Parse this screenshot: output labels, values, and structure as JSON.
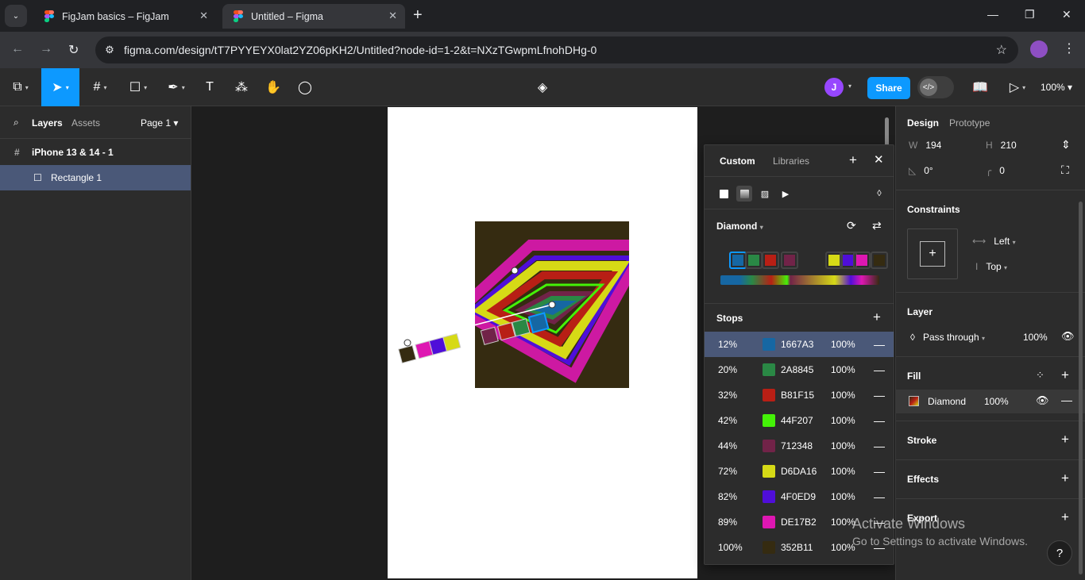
{
  "browser": {
    "tabs": [
      {
        "title": "FigJam basics – FigJam",
        "close": "✕"
      },
      {
        "title": "Untitled – Figma",
        "close": "✕"
      }
    ],
    "new_tab": "+",
    "url": "figma.com/design/tT7PYYEYX0lat2YZ06pKH2/Untitled?node-id=1-2&t=NXzTGwpmLfnohDHg-0",
    "window_controls": {
      "minimize": "—",
      "restore": "❐",
      "close": "✕"
    }
  },
  "toolbar": {
    "avatar": "J",
    "share": "Share",
    "zoom": "100%"
  },
  "left_panel": {
    "tab_layers": "Layers",
    "tab_assets": "Assets",
    "page": "Page 1",
    "layers": [
      {
        "name": "iPhone 13 & 14 - 1",
        "icon": "#"
      },
      {
        "name": "Rectangle 1",
        "icon": "☐"
      }
    ]
  },
  "picker": {
    "tab_custom": "Custom",
    "tab_libraries": "Libraries",
    "gradient_type": "Diamond",
    "stops_label": "Stops",
    "stops": [
      {
        "pos": "12%",
        "hex": "1667A3",
        "opacity": "100%",
        "color": "#1667a3"
      },
      {
        "pos": "20%",
        "hex": "2A8845",
        "opacity": "100%",
        "color": "#2a8845"
      },
      {
        "pos": "32%",
        "hex": "B81F15",
        "opacity": "100%",
        "color": "#b81f15"
      },
      {
        "pos": "42%",
        "hex": "44F207",
        "opacity": "100%",
        "color": "#44f207"
      },
      {
        "pos": "44%",
        "hex": "712348",
        "opacity": "100%",
        "color": "#712348"
      },
      {
        "pos": "72%",
        "hex": "D6DA16",
        "opacity": "100%",
        "color": "#d6da16"
      },
      {
        "pos": "82%",
        "hex": "4F0ED9",
        "opacity": "100%",
        "color": "#4f0ed9"
      },
      {
        "pos": "89%",
        "hex": "DE17B2",
        "opacity": "100%",
        "color": "#de17b2"
      },
      {
        "pos": "100%",
        "hex": "352B11",
        "opacity": "100%",
        "color": "#352b11"
      }
    ]
  },
  "right_panel": {
    "tab_design": "Design",
    "tab_prototype": "Prototype",
    "w_label": "W",
    "w": "194",
    "h_label": "H",
    "h": "210",
    "rotation": "0°",
    "radius": "0",
    "constraints": "Constraints",
    "constraint_h": "Left",
    "constraint_v": "Top",
    "layer": "Layer",
    "blend": "Pass through",
    "layer_opacity": "100%",
    "fill": "Fill",
    "fill_name": "Diamond",
    "fill_opacity": "100%",
    "stroke": "Stroke",
    "effects": "Effects",
    "export": "Export"
  },
  "watermark": {
    "line1": "Activate Windows",
    "line2": "Go to Settings to activate Windows."
  },
  "help": "?"
}
